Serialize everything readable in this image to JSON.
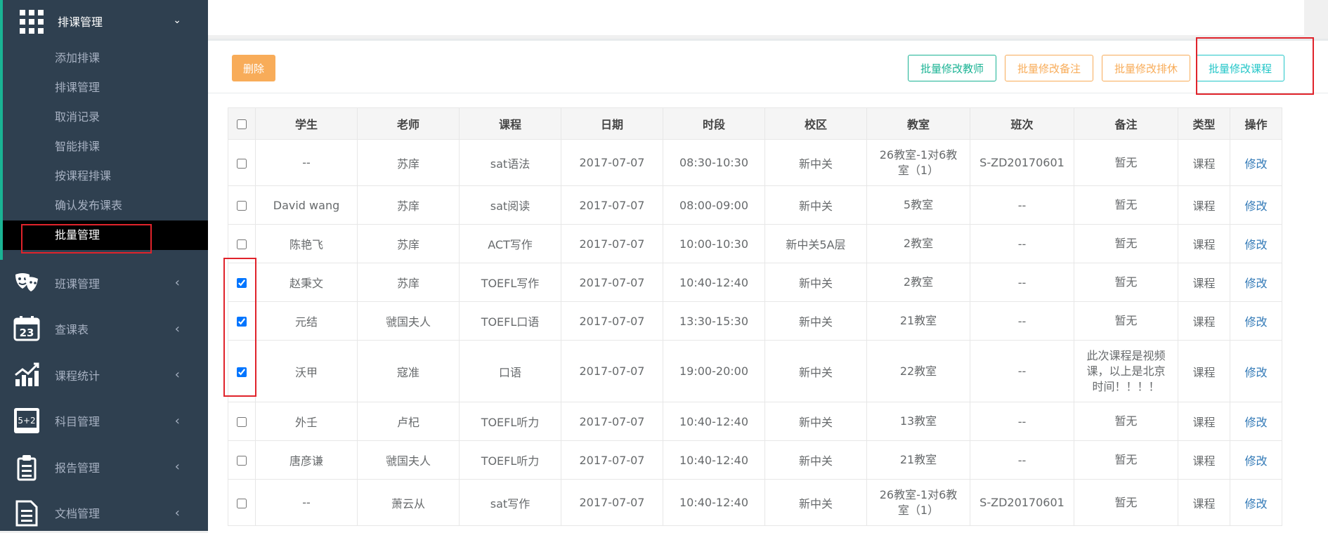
{
  "sidebar": {
    "header": {
      "label": "排课管理",
      "icon": "grid-icon"
    },
    "sub_items": [
      {
        "label": "添加排课"
      },
      {
        "label": "排课管理"
      },
      {
        "label": "取消记录"
      },
      {
        "label": "智能排课"
      },
      {
        "label": "按课程排课"
      },
      {
        "label": "确认发布课表"
      },
      {
        "label": "批量管理",
        "active": true
      }
    ],
    "menu_items": [
      {
        "label": "班课管理",
        "icon": "theater-masks-icon"
      },
      {
        "label": "查课表",
        "icon": "calendar-icon",
        "icon_text": "23"
      },
      {
        "label": "课程统计",
        "icon": "bar-chart-icon"
      },
      {
        "label": "科目管理",
        "icon": "blackboard-icon",
        "icon_text": "5+2"
      },
      {
        "label": "报告管理",
        "icon": "clipboard-icon"
      },
      {
        "label": "文档管理",
        "icon": "document-icon"
      }
    ]
  },
  "toolbar": {
    "delete_label": "删除",
    "batch_teacher_label": "批量修改教师",
    "batch_note_label": "批量修改备注",
    "batch_rest_label": "批量修改排休",
    "batch_course_label": "批量修改课程"
  },
  "table": {
    "headers": [
      "学生",
      "老师",
      "课程",
      "日期",
      "时段",
      "校区",
      "教室",
      "班次",
      "备注",
      "类型",
      "操作"
    ],
    "rows": [
      {
        "checked": false,
        "student": "--",
        "teacher": "苏庠",
        "course": "sat语法",
        "date": "2017-07-07",
        "time": "08:30-10:30",
        "campus": "新中关",
        "room": "26教室-1对6教室（1）",
        "cls": "S-ZD20170601",
        "note": "暂无",
        "type": "课程",
        "action": "修改"
      },
      {
        "checked": false,
        "student": "David wang",
        "teacher": "苏庠",
        "course": "sat阅读",
        "date": "2017-07-07",
        "time": "08:00-09:00",
        "campus": "新中关",
        "room": "5教室",
        "cls": "--",
        "note": "暂无",
        "type": "课程",
        "action": "修改"
      },
      {
        "checked": false,
        "student": "陈艳飞",
        "teacher": "苏庠",
        "course": "ACT写作",
        "date": "2017-07-07",
        "time": "10:00-10:30",
        "campus": "新中关5A层",
        "room": "2教室",
        "cls": "--",
        "note": "暂无",
        "type": "课程",
        "action": "修改"
      },
      {
        "checked": true,
        "student": "赵秉文",
        "teacher": "苏庠",
        "course": "TOEFL写作",
        "date": "2017-07-07",
        "time": "10:40-12:40",
        "campus": "新中关",
        "room": "2教室",
        "cls": "--",
        "note": "暂无",
        "type": "课程",
        "action": "修改"
      },
      {
        "checked": true,
        "student": "元结",
        "teacher": "虢国夫人",
        "course": "TOEFL口语",
        "date": "2017-07-07",
        "time": "13:30-15:30",
        "campus": "新中关",
        "room": "21教室",
        "cls": "--",
        "note": "暂无",
        "type": "课程",
        "action": "修改"
      },
      {
        "checked": true,
        "student": "沃甲",
        "teacher": "寇准",
        "course": "口语",
        "date": "2017-07-07",
        "time": "19:00-20:00",
        "campus": "新中关",
        "room": "22教室",
        "cls": "--",
        "note": "此次课程是视频课，以上是北京时间！！！！",
        "type": "课程",
        "action": "修改"
      },
      {
        "checked": false,
        "student": "外壬",
        "teacher": "卢杞",
        "course": "TOEFL听力",
        "date": "2017-07-07",
        "time": "10:40-12:40",
        "campus": "新中关",
        "room": "13教室",
        "cls": "--",
        "note": "暂无",
        "type": "课程",
        "action": "修改"
      },
      {
        "checked": false,
        "student": "唐彦谦",
        "teacher": "虢国夫人",
        "course": "TOEFL听力",
        "date": "2017-07-07",
        "time": "10:40-12:40",
        "campus": "新中关",
        "room": "21教室",
        "cls": "--",
        "note": "暂无",
        "type": "课程",
        "action": "修改"
      },
      {
        "checked": false,
        "student": "--",
        "teacher": "萧云从",
        "course": "sat写作",
        "date": "2017-07-07",
        "time": "10:40-12:40",
        "campus": "新中关",
        "room": "26教室-1对6教室（1）",
        "cls": "S-ZD20170601",
        "note": "暂无",
        "type": "课程",
        "action": "修改"
      }
    ]
  },
  "colors": {
    "sidebar_bg": "#2f4050",
    "accent_green": "#1ab394",
    "warning_orange": "#f8ac59",
    "info_teal": "#23c6c8",
    "highlight_red": "#e0232b"
  }
}
